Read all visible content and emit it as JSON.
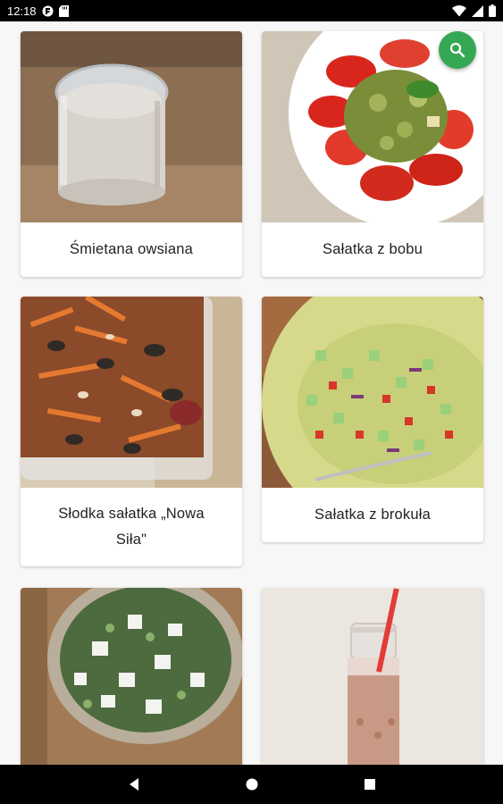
{
  "status_bar": {
    "time": "12:18",
    "left_icons": [
      "notification-app-icon",
      "sd-card-icon"
    ],
    "right_icons": [
      "wifi-icon",
      "cell-signal-icon",
      "battery-icon"
    ]
  },
  "search_fab": {
    "icon": "search-icon",
    "color": "#35a853"
  },
  "recipes": [
    {
      "title": "Śmietana owsiana",
      "image": "jar of oat cream"
    },
    {
      "title": "Sałatka z bobu",
      "image": "tomato and broad bean salad"
    },
    {
      "title": "Słodka sałatka „Nowa Siła\"",
      "image": "carrot and pumpkin seed salad"
    },
    {
      "title": "Sałatka z brokuła",
      "image": "broccoli salad"
    },
    {
      "title": "",
      "image": "feta and greens salad"
    },
    {
      "title": "",
      "image": "smoothie bottle with straw"
    }
  ],
  "navigation": {
    "back": "back-icon",
    "home": "home-icon",
    "recents": "recents-icon"
  }
}
